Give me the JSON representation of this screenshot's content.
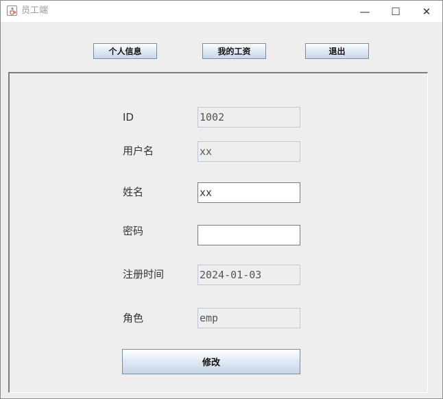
{
  "window": {
    "title": "员工端",
    "controls": {
      "minimize": "—",
      "maximize": "☐",
      "close": "✕"
    }
  },
  "toolbar": {
    "personal_info": "个人信息",
    "my_salary": "我的工资",
    "logout": "退出"
  },
  "form": {
    "id_label": "ID",
    "id_value": "1002",
    "username_label": "用户名",
    "username_value": "xx",
    "name_label": "姓名",
    "name_value": "xx",
    "password_label": "密码",
    "password_value": "",
    "register_time_label": "注册时间",
    "register_time_value": "2024-01-03",
    "role_label": "角色",
    "role_value": "emp",
    "submit_label": "修改"
  },
  "icons": {
    "app": "java-cup-icon"
  },
  "colors": {
    "button_gradient_bottom": "#c9d8e8",
    "readonly_border": "#b8c8d8"
  }
}
